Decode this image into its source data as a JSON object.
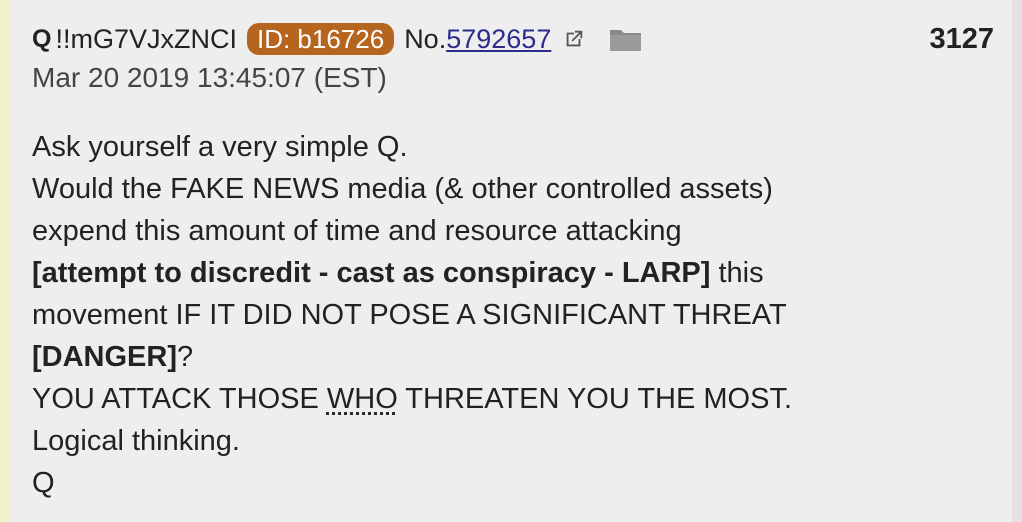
{
  "header": {
    "name": "Q",
    "tripcode": "!!mG7VJxZNCI",
    "id_badge": "ID: b16726",
    "post_prefix": "No.",
    "post_number": "5792657",
    "reply_count": "3127"
  },
  "date": {
    "text": "Mar 20 2019 13:45:07 (EST)"
  },
  "body": {
    "line1": "Ask yourself a very simple Q.",
    "line2": "Would the FAKE NEWS media (& other controlled assets)",
    "line3": "expend this amount of time and resource attacking",
    "line4_bold": "[attempt to discredit - cast as conspiracy - LARP]",
    "line4_rest": " this",
    "line5": "movement IF IT DID NOT POSE A SIGNIFICANT THREAT",
    "line6_bold": "[DANGER]",
    "line6_rest": "?",
    "line7_pre": "YOU ATTACK THOSE ",
    "line7_who": "WHO",
    "line7_post": " THREATEN YOU THE MOST.",
    "line8": "Logical thinking.",
    "signature": "Q"
  },
  "colors": {
    "id_badge_bg": "#b5651d",
    "link": "#2c2c8c",
    "background": "#eeeeee"
  },
  "icons": {
    "external_link": "external-link-icon",
    "folder": "folder-icon"
  }
}
